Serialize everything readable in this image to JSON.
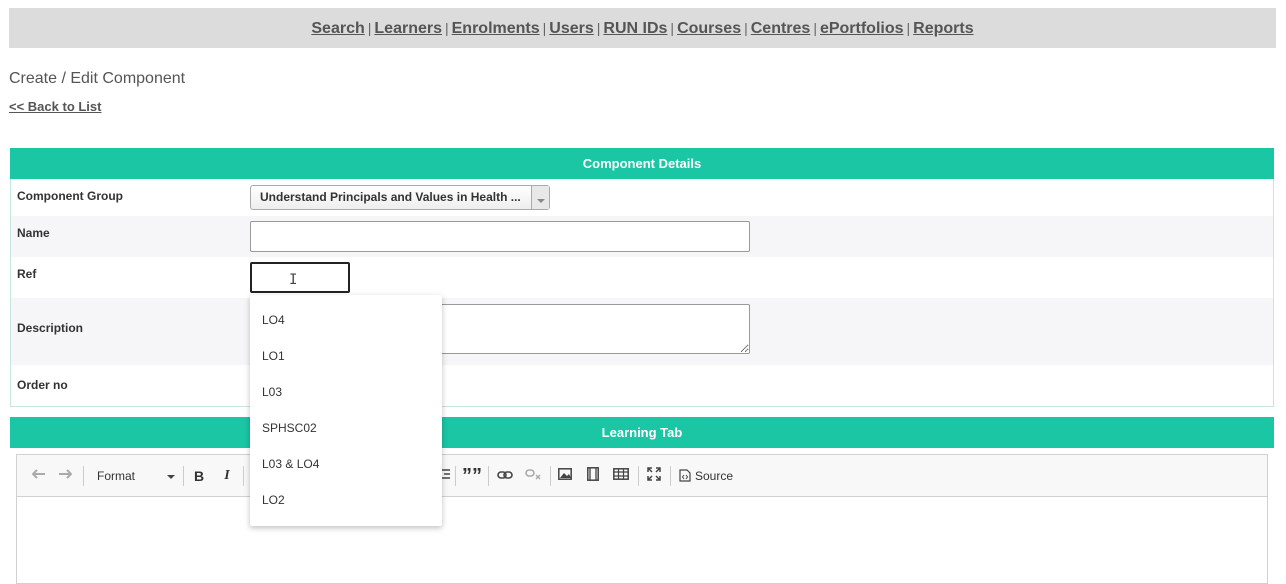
{
  "nav": {
    "items": [
      "Search",
      "Learners",
      "Enrolments",
      "Users",
      "RUN IDs",
      "Courses",
      "Centres",
      "ePortfolios",
      "Reports"
    ],
    "separator": "|"
  },
  "page": {
    "title": "Create / Edit Component",
    "back_link": "<< Back to List"
  },
  "component_details": {
    "header": "Component Details",
    "fields": {
      "component_group_label": "Component Group",
      "component_group_value": "Understand Principals and Values in Health ...",
      "name_label": "Name",
      "name_value": "",
      "ref_label": "Ref",
      "ref_value": "",
      "description_label": "Description",
      "order_no_label": "Order no"
    }
  },
  "ref_autocomplete": {
    "options": [
      "LO4",
      "LO1",
      "L03",
      "SPHSC02",
      "L03 & LO4",
      "LO2"
    ]
  },
  "learning_tab": {
    "header": "Learning Tab",
    "toolbar": {
      "format_label": "Format",
      "bold": "B",
      "italic": "I",
      "blockquote": "””",
      "source_label": "Source"
    }
  },
  "colors": {
    "accent": "#1ac6a4",
    "nav_bg": "#dcdcdc"
  }
}
